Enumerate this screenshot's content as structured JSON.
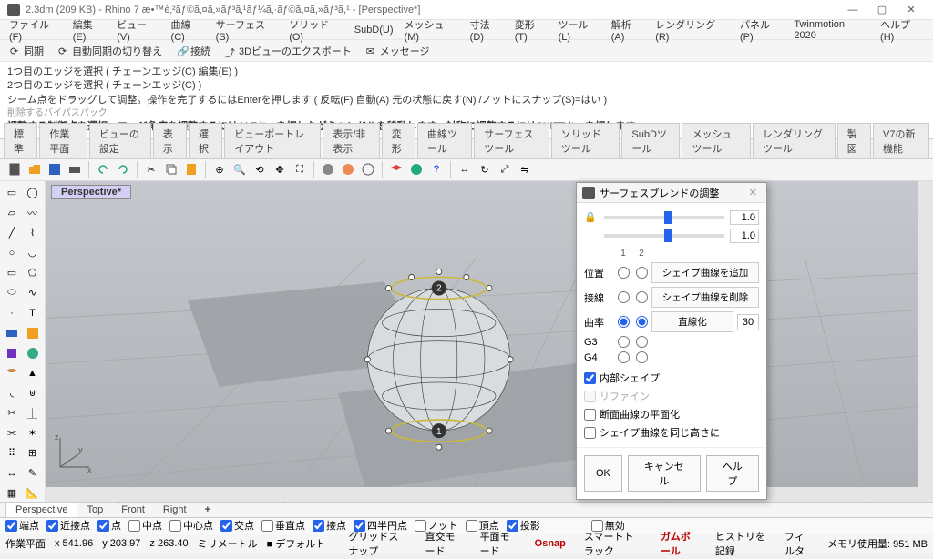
{
  "title": "2.3dm (209 KB) - Rhino 7 æ•™è‚²ãƒ©ã‚¤ã‚»ãƒ³ã‚¹ãƒ¼ã‚·ãƒ©ã,¤ã,»ãƒ³ã,¹ - [Perspective*]",
  "menu": [
    "ファイル(F)",
    "編集(E)",
    "ビュー(V)",
    "曲線(C)",
    "サーフェス(S)",
    "ソリッド(O)",
    "SubD(U)",
    "メッシュ(M)",
    "寸法(D)",
    "変形(T)",
    "ツール(L)",
    "解析(A)",
    "レンダリング(R)",
    "パネル(P)",
    "Twinmotion 2020",
    "ヘルプ(H)"
  ],
  "quick": [
    {
      "label": "同期",
      "icon": "sync-icon"
    },
    {
      "label": "自動同期の切り替え",
      "icon": "autosync-icon"
    },
    {
      "label": "接続",
      "icon": "link-icon"
    },
    {
      "label": "3Dビューのエクスポート",
      "icon": "export-icon"
    },
    {
      "label": "メッセージ",
      "icon": "message-icon"
    }
  ],
  "cmd": {
    "l1": "1つ目のエッジを選択 ( チェーンエッジ(C)  編集(E) )",
    "l2": "2つ目のエッジを選択 ( チェーンエッジ(C) )",
    "l3": "シーム点をドラッグして調整。操作を完了するにはEnterを押します ( 反転(F)  自動(A)  元の状態に戻す(N)  /ノットにスナップ(S)=はい )",
    "l4": "削除するバイパスパック",
    "prompt": "調整する制御点を選択。エッジ角度を調整するにはALTキーを押しながらハンドルを移動します。対称に調整するにはSHIFTキーを押します:"
  },
  "tabs": [
    "標準",
    "作業平面",
    "ビューの設定",
    "表示",
    "選択",
    "ビューポートレイアウト",
    "表示/非表示",
    "変形",
    "曲線ツール",
    "サーフェスツール",
    "ソリッドツール",
    "SubDツール",
    "メッシュツール",
    "レンダリングツール",
    "製図",
    "V7の新機能"
  ],
  "viewport": {
    "title": "Perspective*"
  },
  "vptabs": [
    "Perspective",
    "Top",
    "Front",
    "Right"
  ],
  "osnap": [
    {
      "label": "端点",
      "checked": true
    },
    {
      "label": "近接点",
      "checked": true
    },
    {
      "label": "点",
      "checked": true
    },
    {
      "label": "中点",
      "checked": false
    },
    {
      "label": "中心点",
      "checked": false
    },
    {
      "label": "交点",
      "checked": true
    },
    {
      "label": "垂直点",
      "checked": false
    },
    {
      "label": "接点",
      "checked": true
    },
    {
      "label": "四半円点",
      "checked": true
    },
    {
      "label": "ノット",
      "checked": false
    },
    {
      "label": "頂点",
      "checked": false
    },
    {
      "label": "投影",
      "checked": true
    },
    {
      "label": "無効",
      "checked": false
    }
  ],
  "status": {
    "plane": "作業平面",
    "x": "x 541.96",
    "y": "y 203.97",
    "z": "z 263.40",
    "units": "ミリメートル",
    "layer": "デフォルト",
    "items": [
      "グリッドスナップ",
      "直交モード",
      "平面モード",
      "Osnap",
      "スマートトラック",
      "ガムボール",
      "ヒストリを記録",
      "フィルタ"
    ],
    "mem": "メモリ使用量: 951 MB"
  },
  "dialog": {
    "title": "サーフェスブレンドの調整",
    "val1": "1.0",
    "val2": "1.0",
    "col1": "1",
    "col2": "2",
    "rows": [
      "位置",
      "接線",
      "曲率",
      "G3",
      "G4"
    ],
    "addShape": "シェイプ曲線を追加",
    "delShape": "シェイプ曲線を削除",
    "straighten": "直線化",
    "num": "30",
    "inner": "内部シェイプ",
    "refine": "リファイン",
    "planar": "断面曲線の平面化",
    "sameHeight": "シェイプ曲線を同じ高さに",
    "ok": "OK",
    "cancel": "キャンセル",
    "help": "ヘルプ"
  }
}
